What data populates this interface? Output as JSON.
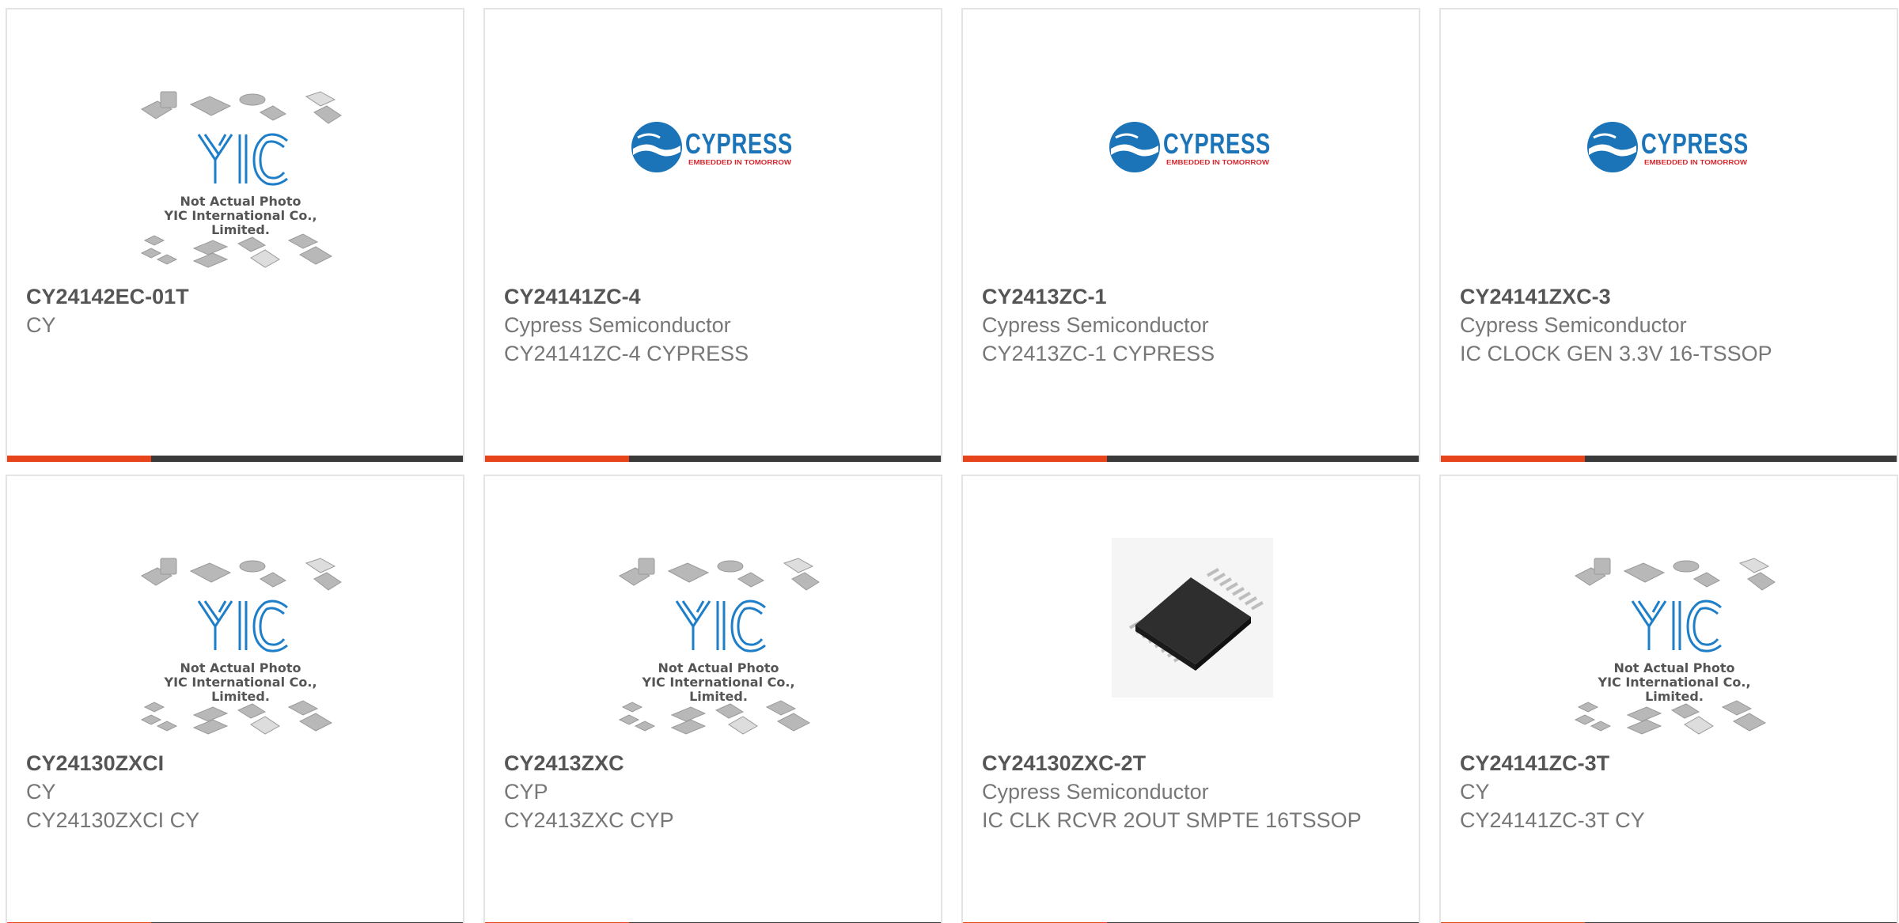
{
  "colors": {
    "accent": "#e8441c",
    "bar": "#3a3a3a",
    "yic_blue": "#1e7fc8",
    "cypress_blue": "#1b74b8",
    "cypress_red": "#d8262c"
  },
  "products": [
    {
      "part": "CY24142EC-01T",
      "maker": "CY",
      "desc": "",
      "image": "yic-placeholder"
    },
    {
      "part": "CY24141ZC-4",
      "maker": "Cypress Semiconductor",
      "desc": "CY24141ZC-4 CYPRESS",
      "image": "cypress-logo"
    },
    {
      "part": "CY2413ZC-1",
      "maker": "Cypress Semiconductor",
      "desc": "CY2413ZC-1 CYPRESS",
      "image": "cypress-logo"
    },
    {
      "part": "CY24141ZXC-3",
      "maker": "Cypress Semiconductor",
      "desc": "IC CLOCK GEN 3.3V 16-TSSOP",
      "image": "cypress-logo"
    },
    {
      "part": "CY24130ZXCI",
      "maker": "CY",
      "desc": "CY24130ZXCI CY",
      "image": "yic-placeholder"
    },
    {
      "part": "CY2413ZXC",
      "maker": "CYP",
      "desc": "CY2413ZXC CYP",
      "image": "yic-placeholder"
    },
    {
      "part": "CY24130ZXC-2T",
      "maker": "Cypress Semiconductor",
      "desc": "IC CLK RCVR 2OUT SMPTE 16TSSOP",
      "image": "chip-photo"
    },
    {
      "part": "CY24141ZC-3T",
      "maker": "CY",
      "desc": "CY24141ZC-3T CY",
      "image": "yic-placeholder"
    }
  ],
  "placeholder": {
    "line1": "Not Actual Photo",
    "line2": "YIC International Co., Limited."
  },
  "logo": {
    "word": "CYPRESS",
    "tagline": "EMBEDDED IN TOMORROW"
  }
}
